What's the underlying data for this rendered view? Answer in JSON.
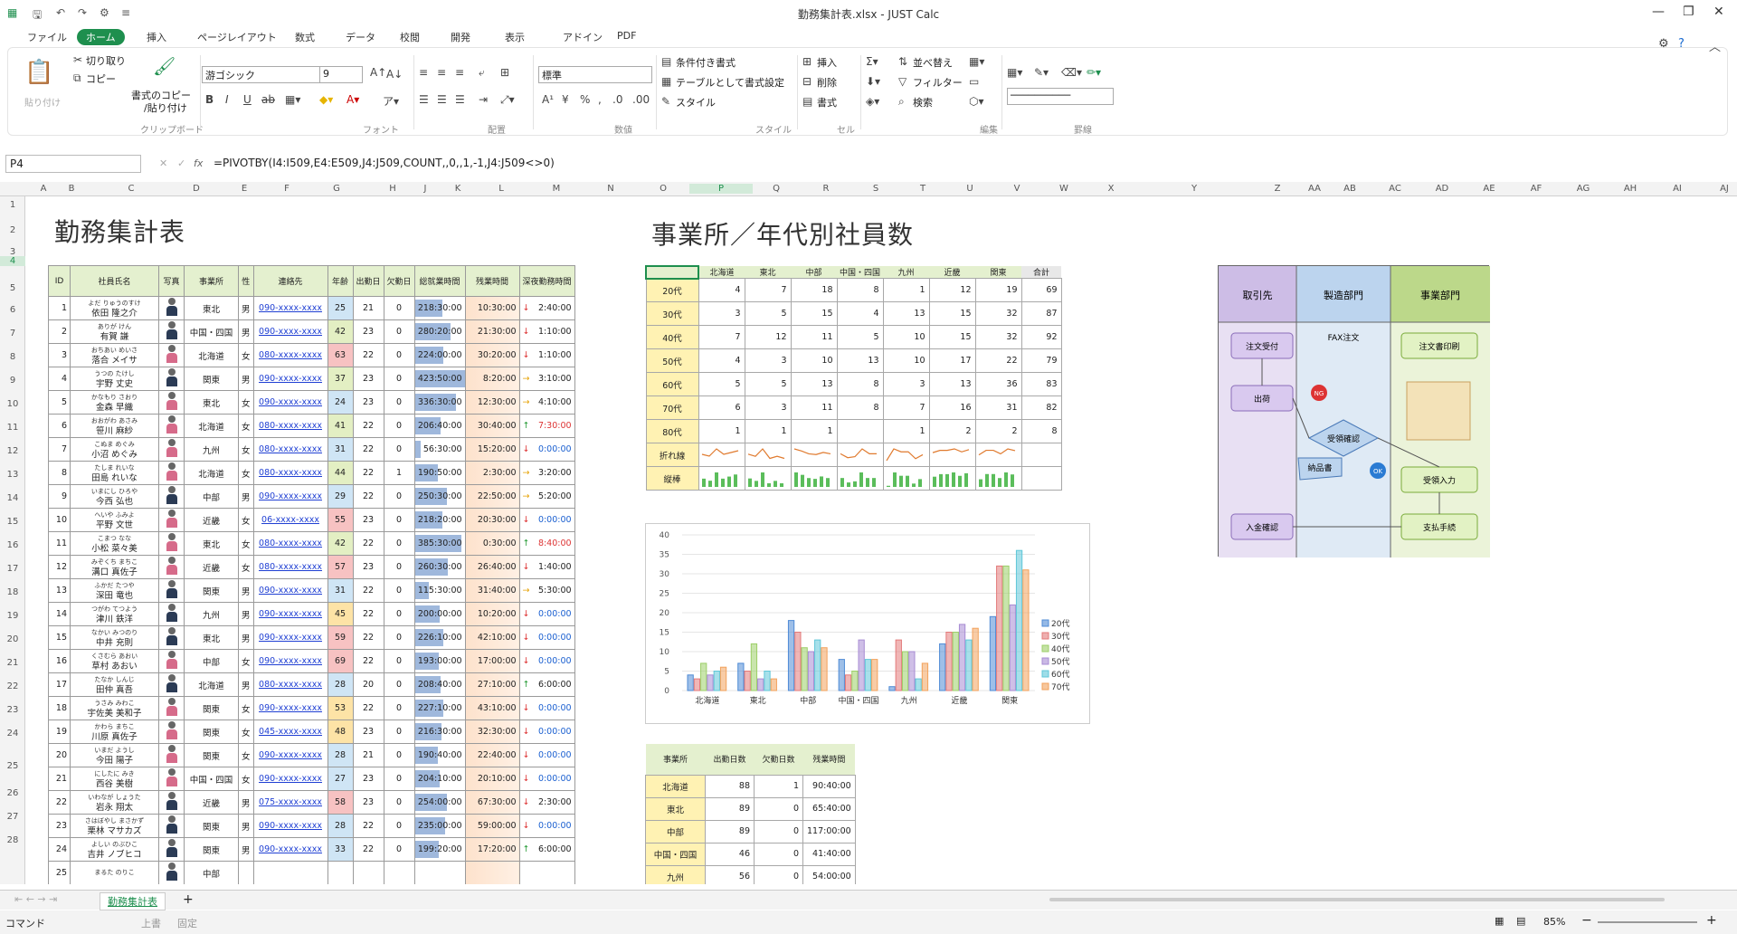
{
  "window": {
    "title": "勤務集計表.xlsx - JUST Calc",
    "app_icon": "spreadsheet-icon"
  },
  "ribbon": {
    "tabs": [
      "ファイル",
      "ホーム",
      "挿入",
      "ページレイアウト",
      "数式",
      "データ",
      "校閲",
      "開発",
      "表示",
      "アドイン",
      "PDF"
    ],
    "active_tab": "ホーム",
    "clipboard": {
      "paste": "貼り付け",
      "cut": "切り取り",
      "copy": "コピー",
      "format_copy": "書式のコピー",
      "format_paste": "/貼り付け",
      "group": "クリップボード"
    },
    "font": {
      "name": "游ゴシック",
      "size": "9",
      "group": "フォント"
    },
    "align": {
      "group": "配置"
    },
    "number": {
      "format": "標準",
      "group": "数値"
    },
    "style": {
      "cond": "条件付き書式",
      "table": "テーブルとして書式設定",
      "style": "スタイル",
      "group": "スタイル"
    },
    "cell": {
      "insert": "挿入",
      "delete": "削除",
      "format": "書式",
      "group": "セル"
    },
    "edit": {
      "sort": "並べ替え",
      "filter": "フィルター",
      "find": "検索",
      "group": "編集"
    },
    "ruled": {
      "group": "罫線"
    }
  },
  "formula_bar": {
    "name_box": "P4",
    "fx": "fx",
    "formula": "=PIVOTBY(I4:I509,E4:E509,J4:J509,COUNT,,0,,1,-1,J4:J509<>0)"
  },
  "columns": [
    "A",
    "B",
    "C",
    "D",
    "E",
    "F",
    "G",
    "H",
    "J",
    "K",
    "L",
    "M",
    "N",
    "O",
    "P",
    "Q",
    "R",
    "S",
    "T",
    "U",
    "V",
    "W",
    "X",
    "Y",
    "Z",
    "AA",
    "AB",
    "AC",
    "AD",
    "AE",
    "AF",
    "AG",
    "AH",
    "AI",
    "AJ"
  ],
  "rows": [
    "1",
    "2",
    "3",
    "4",
    "5",
    "6",
    "7",
    "8",
    "9",
    "10",
    "11",
    "12",
    "13",
    "14",
    "15",
    "16",
    "17",
    "18",
    "19",
    "20",
    "21",
    "22",
    "23",
    "24",
    "25",
    "26",
    "27",
    "28"
  ],
  "titles": {
    "left": "勤務集計表",
    "right": "事業所／年代別社員数"
  },
  "main_table": {
    "headers": [
      "ID",
      "社員氏名",
      "写真",
      "事業所",
      "性",
      "連絡先",
      "年齢",
      "出勤日",
      "欠勤日",
      "総就業時間",
      "残業時間",
      "深夜勤務時間"
    ],
    "rows": [
      {
        "id": "1",
        "kana": "よだ りゅうのすけ",
        "name": "依田 隆之介",
        "office": "東北",
        "sex": "男",
        "tel": "090-xxxx-xxxx",
        "age": "25",
        "work": "21",
        "abs": "0",
        "total": "218:30:00",
        "total_pct": 0.56,
        "over": "10:30:00",
        "night": "2:40:00",
        "arrow": "↓",
        "red": false,
        "f": false
      },
      {
        "id": "2",
        "kana": "ありが けん",
        "name": "有賀 謙",
        "office": "中国・四国",
        "sex": "男",
        "tel": "090-xxxx-xxxx",
        "age": "42",
        "work": "23",
        "abs": "0",
        "total": "280:20:00",
        "total_pct": 0.72,
        "over": "21:30:00",
        "night": "1:10:00",
        "arrow": "↓",
        "red": false,
        "f": false
      },
      {
        "id": "3",
        "kana": "おちあい めいさ",
        "name": "落合 メイサ",
        "office": "北海道",
        "sex": "女",
        "tel": "080-xxxx-xxxx",
        "age": "63",
        "work": "22",
        "abs": "0",
        "total": "224:00:00",
        "total_pct": 0.58,
        "over": "30:20:00",
        "night": "1:10:00",
        "arrow": "↓",
        "red": false,
        "f": true
      },
      {
        "id": "4",
        "kana": "うつの たけし",
        "name": "宇野 丈史",
        "office": "関東",
        "sex": "男",
        "tel": "090-xxxx-xxxx",
        "age": "37",
        "work": "23",
        "abs": "0",
        "total": "423:50:00",
        "total_pct": 1.0,
        "over": "8:20:00",
        "night": "3:10:00",
        "arrow": "→",
        "red": false,
        "f": false
      },
      {
        "id": "5",
        "kana": "かなもり さおり",
        "name": "金森 早織",
        "office": "東北",
        "sex": "女",
        "tel": "090-xxxx-xxxx",
        "age": "24",
        "work": "23",
        "abs": "0",
        "total": "336:30:00",
        "total_pct": 0.82,
        "over": "12:30:00",
        "night": "4:10:00",
        "arrow": "→",
        "red": false,
        "f": true
      },
      {
        "id": "6",
        "kana": "おおがわ あさみ",
        "name": "笹川 麻紗",
        "office": "北海道",
        "sex": "女",
        "tel": "080-xxxx-xxxx",
        "age": "41",
        "work": "22",
        "abs": "0",
        "total": "206:40:00",
        "total_pct": 0.52,
        "over": "30:40:00",
        "night": "7:30:00",
        "arrow": "↑",
        "red": true,
        "f": true
      },
      {
        "id": "7",
        "kana": "こぬま めぐみ",
        "name": "小沼 めぐみ",
        "office": "九州",
        "sex": "女",
        "tel": "080-xxxx-xxxx",
        "age": "31",
        "work": "22",
        "abs": "0",
        "total": "56:30:00",
        "total_pct": 0.12,
        "over": "15:20:00",
        "night": "0:00:00",
        "arrow": "↓",
        "red": false,
        "f": true
      },
      {
        "id": "8",
        "kana": "たしま れいな",
        "name": "田島 れいな",
        "office": "北海道",
        "sex": "女",
        "tel": "080-xxxx-xxxx",
        "age": "44",
        "work": "22",
        "abs": "1",
        "total": "190:50:00",
        "total_pct": 0.46,
        "over": "2:30:00",
        "night": "3:20:00",
        "arrow": "→",
        "red": false,
        "f": true
      },
      {
        "id": "9",
        "kana": "いまにし ひろや",
        "name": "今西 弘也",
        "office": "中部",
        "sex": "男",
        "tel": "090-xxxx-xxxx",
        "age": "29",
        "work": "22",
        "abs": "0",
        "total": "250:30:00",
        "total_pct": 0.64,
        "over": "22:50:00",
        "night": "5:20:00",
        "arrow": "→",
        "red": false,
        "f": false
      },
      {
        "id": "10",
        "kana": "へいや ふみよ",
        "name": "平野 文世",
        "office": "近畿",
        "sex": "女",
        "tel": "06-xxxx-xxxx",
        "age": "55",
        "work": "23",
        "abs": "0",
        "total": "218:20:00",
        "total_pct": 0.56,
        "over": "20:30:00",
        "night": "0:00:00",
        "arrow": "↓",
        "red": false,
        "f": true
      },
      {
        "id": "11",
        "kana": "こまつ なな",
        "name": "小松 菜々美",
        "office": "東北",
        "sex": "女",
        "tel": "080-xxxx-xxxx",
        "age": "42",
        "work": "22",
        "abs": "0",
        "total": "385:30:00",
        "total_pct": 0.94,
        "over": "0:30:00",
        "night": "8:40:00",
        "arrow": "↑",
        "red": true,
        "f": true
      },
      {
        "id": "12",
        "kana": "みぞくち まちこ",
        "name": "溝口 真佐子",
        "office": "近畿",
        "sex": "女",
        "tel": "080-xxxx-xxxx",
        "age": "57",
        "work": "23",
        "abs": "0",
        "total": "260:30:00",
        "total_pct": 0.66,
        "over": "26:40:00",
        "night": "1:40:00",
        "arrow": "↓",
        "red": false,
        "f": true
      },
      {
        "id": "13",
        "kana": "ふかだ たつや",
        "name": "深田 竜也",
        "office": "関東",
        "sex": "男",
        "tel": "090-xxxx-xxxx",
        "age": "31",
        "work": "22",
        "abs": "0",
        "total": "115:30:00",
        "total_pct": 0.28,
        "over": "31:40:00",
        "night": "5:30:00",
        "arrow": "→",
        "red": false,
        "f": false
      },
      {
        "id": "14",
        "kana": "つがわ てつよう",
        "name": "津川 鉄洋",
        "office": "九州",
        "sex": "男",
        "tel": "090-xxxx-xxxx",
        "age": "45",
        "work": "22",
        "abs": "0",
        "total": "200:00:00",
        "total_pct": 0.5,
        "over": "10:20:00",
        "night": "0:00:00",
        "arrow": "↓",
        "red": false,
        "f": false
      },
      {
        "id": "15",
        "kana": "なかい みつのり",
        "name": "中井 充則",
        "office": "東北",
        "sex": "男",
        "tel": "090-xxxx-xxxx",
        "age": "59",
        "work": "22",
        "abs": "0",
        "total": "226:10:00",
        "total_pct": 0.58,
        "over": "42:10:00",
        "night": "0:00:00",
        "arrow": "↓",
        "red": false,
        "f": false
      },
      {
        "id": "16",
        "kana": "くさむら あおい",
        "name": "草村 あおい",
        "office": "中部",
        "sex": "女",
        "tel": "090-xxxx-xxxx",
        "age": "69",
        "work": "22",
        "abs": "0",
        "total": "193:00:00",
        "total_pct": 0.48,
        "over": "17:00:00",
        "night": "0:00:00",
        "arrow": "↓",
        "red": false,
        "f": true
      },
      {
        "id": "17",
        "kana": "たなか しんじ",
        "name": "田仲 真吾",
        "office": "北海道",
        "sex": "男",
        "tel": "080-xxxx-xxxx",
        "age": "28",
        "work": "20",
        "abs": "0",
        "total": "208:40:00",
        "total_pct": 0.52,
        "over": "27:10:00",
        "night": "6:00:00",
        "arrow": "↑",
        "red": false,
        "f": false
      },
      {
        "id": "18",
        "kana": "うさみ みわこ",
        "name": "宇佐美 美和子",
        "office": "関東",
        "sex": "女",
        "tel": "090-xxxx-xxxx",
        "age": "53",
        "work": "22",
        "abs": "0",
        "total": "227:10:00",
        "total_pct": 0.58,
        "over": "43:10:00",
        "night": "0:00:00",
        "arrow": "↓",
        "red": false,
        "f": true
      },
      {
        "id": "19",
        "kana": "かわら まちこ",
        "name": "川原 真佐子",
        "office": "関東",
        "sex": "女",
        "tel": "045-xxxx-xxxx",
        "age": "48",
        "work": "23",
        "abs": "0",
        "total": "216:30:00",
        "total_pct": 0.54,
        "over": "32:30:00",
        "night": "0:00:00",
        "arrow": "↓",
        "red": false,
        "f": true
      },
      {
        "id": "20",
        "kana": "いまだ ようし",
        "name": "今田 陽子",
        "office": "関東",
        "sex": "女",
        "tel": "090-xxxx-xxxx",
        "age": "28",
        "work": "21",
        "abs": "0",
        "total": "190:40:00",
        "total_pct": 0.46,
        "over": "22:40:00",
        "night": "0:00:00",
        "arrow": "↓",
        "red": false,
        "f": true
      },
      {
        "id": "21",
        "kana": "にしたに みき",
        "name": "西谷 美樹",
        "office": "中国・四国",
        "sex": "女",
        "tel": "090-xxxx-xxxx",
        "age": "27",
        "work": "23",
        "abs": "0",
        "total": "204:10:00",
        "total_pct": 0.5,
        "over": "20:10:00",
        "night": "0:00:00",
        "arrow": "↓",
        "red": false,
        "f": true
      },
      {
        "id": "22",
        "kana": "いわなが しょうた",
        "name": "岩永 翔太",
        "office": "近畿",
        "sex": "男",
        "tel": "075-xxxx-xxxx",
        "age": "58",
        "work": "23",
        "abs": "0",
        "total": "254:00:00",
        "total_pct": 0.64,
        "over": "67:30:00",
        "night": "2:30:00",
        "arrow": "↓",
        "red": false,
        "f": false
      },
      {
        "id": "23",
        "kana": "さはぼやし まさかず",
        "name": "栗林 マサカズ",
        "office": "関東",
        "sex": "男",
        "tel": "090-xxxx-xxxx",
        "age": "28",
        "work": "22",
        "abs": "0",
        "total": "235:00:00",
        "total_pct": 0.6,
        "over": "59:00:00",
        "night": "0:00:00",
        "arrow": "↓",
        "red": false,
        "f": false
      },
      {
        "id": "24",
        "kana": "よしい のぶひこ",
        "name": "吉井 ノブヒコ",
        "office": "関東",
        "sex": "男",
        "tel": "090-xxxx-xxxx",
        "age": "33",
        "work": "22",
        "abs": "0",
        "total": "199:20:00",
        "total_pct": 0.48,
        "over": "17:20:00",
        "night": "6:00:00",
        "arrow": "↑",
        "red": false,
        "f": false
      },
      {
        "id": "25",
        "kana": "まるた のりこ",
        "name": "",
        "office": "中部",
        "sex": "",
        "tel": "",
        "age": "",
        "work": "",
        "abs": "",
        "total": "",
        "total_pct": 0.0,
        "over": "",
        "night": "",
        "arrow": "",
        "red": false,
        "f": false
      }
    ]
  },
  "pivot": {
    "cols": [
      "北海道",
      "東北",
      "中部",
      "中国・四国",
      "九州",
      "近畿",
      "関東",
      "合計"
    ],
    "rows": [
      {
        "label": "20代",
        "v": [
          "4",
          "7",
          "18",
          "8",
          "1",
          "12",
          "19",
          "69"
        ]
      },
      {
        "label": "30代",
        "v": [
          "3",
          "5",
          "15",
          "4",
          "13",
          "15",
          "32",
          "87"
        ]
      },
      {
        "label": "40代",
        "v": [
          "7",
          "12",
          "11",
          "5",
          "10",
          "15",
          "32",
          "92"
        ]
      },
      {
        "label": "50代",
        "v": [
          "4",
          "3",
          "10",
          "13",
          "10",
          "17",
          "22",
          "79"
        ]
      },
      {
        "label": "60代",
        "v": [
          "5",
          "5",
          "13",
          "8",
          "3",
          "13",
          "36",
          "83"
        ]
      },
      {
        "label": "70代",
        "v": [
          "6",
          "3",
          "11",
          "8",
          "7",
          "16",
          "31",
          "82"
        ]
      },
      {
        "label": "80代",
        "v": [
          "1",
          "1",
          "1",
          "",
          "1",
          "2",
          "2",
          "8"
        ]
      }
    ],
    "spark_line_label": "折れ線",
    "spark_bar_label": "縦棒"
  },
  "chart_data": {
    "type": "bar",
    "categories": [
      "北海道",
      "東北",
      "中部",
      "中国・四国",
      "九州",
      "近畿",
      "関東"
    ],
    "series": [
      {
        "name": "20代",
        "values": [
          4,
          7,
          18,
          8,
          1,
          12,
          19
        ]
      },
      {
        "name": "30代",
        "values": [
          3,
          5,
          15,
          4,
          13,
          15,
          32
        ]
      },
      {
        "name": "40代",
        "values": [
          7,
          12,
          11,
          5,
          10,
          15,
          32
        ]
      },
      {
        "name": "50代",
        "values": [
          4,
          3,
          10,
          13,
          10,
          17,
          22
        ]
      },
      {
        "name": "60代",
        "values": [
          5,
          5,
          13,
          8,
          3,
          13,
          36
        ]
      },
      {
        "name": "70代",
        "values": [
          6,
          3,
          11,
          8,
          7,
          16,
          31
        ]
      }
    ],
    "colors": [
      "#4f8bd6",
      "#e37a7a",
      "#9ccf68",
      "#a78bd3",
      "#5fc7d8",
      "#f2a25c"
    ],
    "yticks": [
      "40",
      "35",
      "30",
      "25",
      "20",
      "15",
      "10",
      "5",
      "0"
    ],
    "ylim": [
      0,
      40
    ],
    "legend": "right"
  },
  "summary": {
    "headers": [
      "事業所",
      "出勤日数",
      "欠勤日数",
      "残業時間"
    ],
    "rows": [
      [
        "北海道",
        "88",
        "1",
        "90:40:00"
      ],
      [
        "東北",
        "89",
        "0",
        "65:40:00"
      ],
      [
        "中部",
        "89",
        "0",
        "117:00:00"
      ],
      [
        "中国・四国",
        "46",
        "0",
        "41:40:00"
      ],
      [
        "九州",
        "56",
        "0",
        "54:00:00"
      ]
    ]
  },
  "flow": {
    "lanes": [
      "取引先",
      "製造部門",
      "事業部門"
    ],
    "boxes": {
      "order_recv": "注文受付",
      "ship": "出荷",
      "payment": "入金確認",
      "fax": "FAX注文",
      "print": "注文書印刷",
      "confirm": "受領確認",
      "delivery": "納品書",
      "input": "受領入力",
      "pay": "支払手続",
      "ng": "NG",
      "ok": "OK"
    }
  },
  "sheet": {
    "tab": "勤務集計表"
  },
  "status": {
    "mode": "コマンド",
    "overwrite": "上書",
    "fixed": "固定",
    "zoom": "85%"
  }
}
